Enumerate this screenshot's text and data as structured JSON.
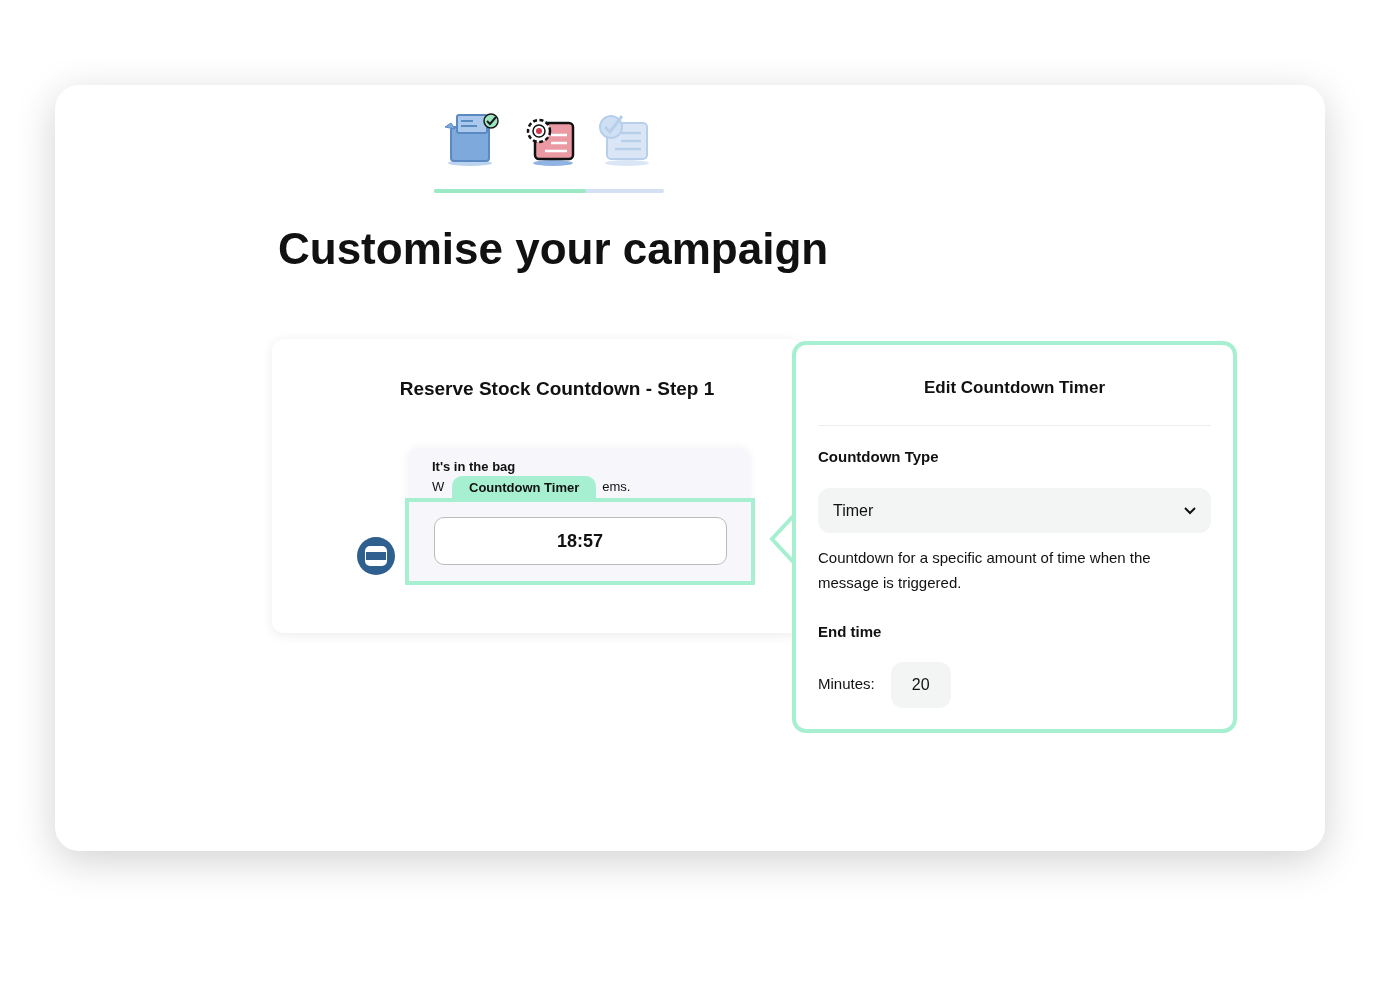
{
  "steps": [
    {
      "kind": "box",
      "completed": true,
      "selected": false
    },
    {
      "kind": "gear",
      "completed": false,
      "selected": true
    },
    {
      "kind": "checklist",
      "completed": false,
      "selected": false
    }
  ],
  "progress": {
    "level": 0.66
  },
  "title": "Customise your campaign",
  "preview": {
    "title": "Reserve Stock Countdown - Step 1",
    "message_title": "It's in the bag",
    "message_start": "W",
    "message_end": "ems.",
    "tag": "Countdown Timer",
    "timer": "18:57"
  },
  "editor": {
    "title": "Edit Countdown Timer",
    "type_label": "Countdown Type",
    "type_value": "Timer",
    "description": "Countdown for a specific amount of time when the message is triggered.",
    "end_label": "End time",
    "minutes_label": "Minutes:",
    "minutes_value": "20"
  }
}
